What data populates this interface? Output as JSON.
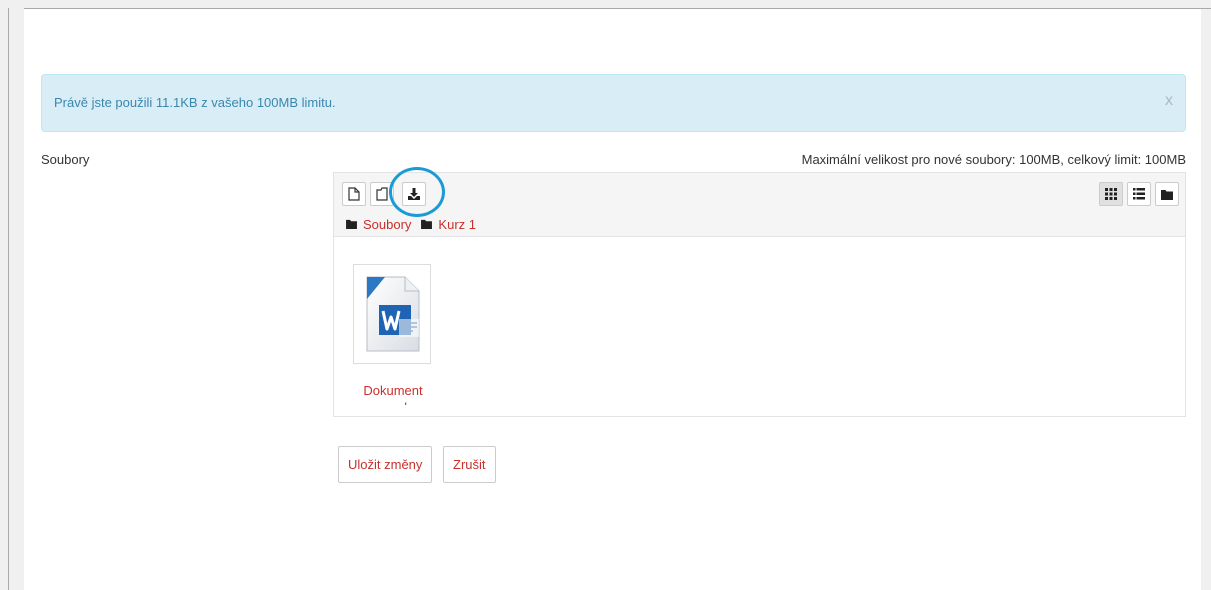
{
  "alert": {
    "message": "Právě jste použili 11.1KB z vašeho 100MB limitu.",
    "close_label": "x"
  },
  "form": {
    "field_label": "Soubory",
    "limit_text": "Maximální velikost pro nové soubory: 100MB, celkový limit: 100MB"
  },
  "file_manager": {
    "toolbar": {
      "add_file_icon": "new-file-icon",
      "create_folder_icon": "new-folder-icon",
      "download_icon": "download-icon",
      "view_modes": [
        "grid-view-icon",
        "list-view-icon",
        "tree-view-icon"
      ],
      "active_view": "grid-view-icon"
    },
    "breadcrumb": [
      "Soubory",
      "Kurz 1"
    ],
    "files": [
      {
        "name": "Dokument",
        "name_cut": "word",
        "icon": "word-document-icon"
      }
    ]
  },
  "actions": {
    "save_label": "Uložit změny",
    "cancel_label": "Zrušit"
  },
  "colors": {
    "alert_bg": "#d9edf7",
    "alert_text": "#3a87ad",
    "link": "#c9302c",
    "highlight": "#1a9bd7"
  }
}
